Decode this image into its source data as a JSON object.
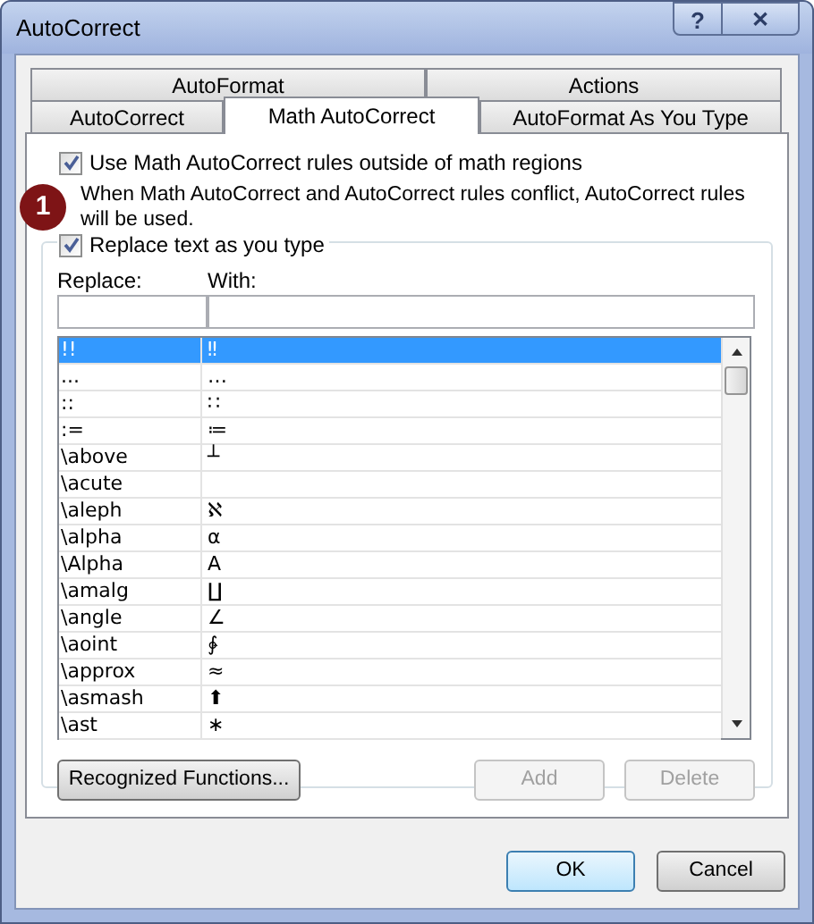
{
  "window": {
    "title": "AutoCorrect",
    "help": "?",
    "close": "✕"
  },
  "tab_rows": [
    [
      {
        "label": "AutoFormat",
        "selected": false
      },
      {
        "label": "Actions",
        "selected": false
      }
    ],
    [
      {
        "label": "AutoCorrect",
        "selected": false
      },
      {
        "label": "Math AutoCorrect",
        "selected": true
      },
      {
        "label": "AutoFormat As You Type",
        "selected": false
      }
    ]
  ],
  "use_outside": {
    "label": "Use Math AutoCorrect rules outside of math regions",
    "checked": true
  },
  "callout": "1",
  "note": "When Math AutoCorrect and AutoCorrect rules conflict, AutoCorrect rules will be used.",
  "replace_as_you_type": {
    "label": "Replace text as you type",
    "checked": true
  },
  "columns": [
    "Replace:",
    "With:"
  ],
  "rows": [
    {
      "replace": "!!",
      "with": "‼",
      "selected": true
    },
    {
      "replace": "...",
      "with": "…",
      "selected": false
    },
    {
      "replace": "::",
      "with": "∷",
      "selected": false
    },
    {
      "replace": ":=",
      "with": "≔",
      "selected": false
    },
    {
      "replace": "\\above",
      "with": "┴",
      "selected": false
    },
    {
      "replace": "\\acute",
      "with": "",
      "selected": false
    },
    {
      "replace": "\\aleph",
      "with": "ℵ",
      "selected": false
    },
    {
      "replace": "\\alpha",
      "with": "α",
      "selected": false
    },
    {
      "replace": "\\Alpha",
      "with": "Α",
      "selected": false
    },
    {
      "replace": "\\amalg",
      "with": "∐",
      "selected": false
    },
    {
      "replace": "\\angle",
      "with": "∠",
      "selected": false
    },
    {
      "replace": "\\aoint",
      "with": "∳",
      "selected": false
    },
    {
      "replace": "\\approx",
      "with": "≈",
      "selected": false
    },
    {
      "replace": "\\asmash",
      "with": "⬆",
      "selected": false
    },
    {
      "replace": "\\ast",
      "with": "∗",
      "selected": false
    }
  ],
  "buttons": [
    {
      "label": "Recognized Functions...",
      "disabled": false
    },
    {
      "label": "Add",
      "disabled": true
    },
    {
      "label": "Delete",
      "disabled": true
    }
  ],
  "footer_buttons": [
    {
      "label": "OK",
      "default": true
    },
    {
      "label": "Cancel",
      "default": false
    }
  ]
}
